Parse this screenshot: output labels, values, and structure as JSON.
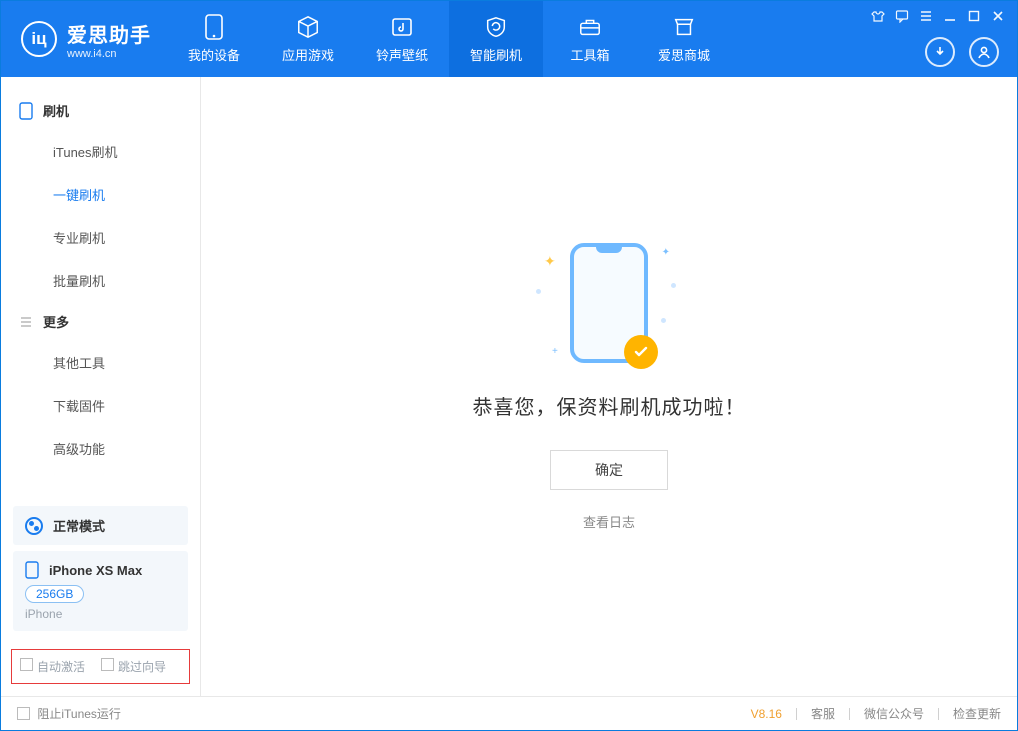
{
  "app": {
    "name": "爱思助手",
    "site": "www.i4.cn"
  },
  "nav": {
    "items": [
      {
        "label": "我的设备"
      },
      {
        "label": "应用游戏"
      },
      {
        "label": "铃声壁纸"
      },
      {
        "label": "智能刷机"
      },
      {
        "label": "工具箱"
      },
      {
        "label": "爱思商城"
      }
    ]
  },
  "sidebar": {
    "sections": [
      {
        "title": "刷机",
        "items": [
          {
            "label": "iTunes刷机"
          },
          {
            "label": "一键刷机"
          },
          {
            "label": "专业刷机"
          },
          {
            "label": "批量刷机"
          }
        ]
      },
      {
        "title": "更多",
        "items": [
          {
            "label": "其他工具"
          },
          {
            "label": "下载固件"
          },
          {
            "label": "高级功能"
          }
        ]
      }
    ],
    "mode_label": "正常模式",
    "device": {
      "name": "iPhone XS Max",
      "capacity": "256GB",
      "type": "iPhone"
    },
    "checkboxes": {
      "auto_activate": "自动激活",
      "skip_wizard": "跳过向导"
    }
  },
  "main": {
    "success_msg": "恭喜您，保资料刷机成功啦！",
    "ok_button": "确定",
    "view_log": "查看日志"
  },
  "status": {
    "block_itunes": "阻止iTunes运行",
    "version": "V8.16",
    "links": {
      "support": "客服",
      "wechat": "微信公众号",
      "update": "检查更新"
    }
  }
}
